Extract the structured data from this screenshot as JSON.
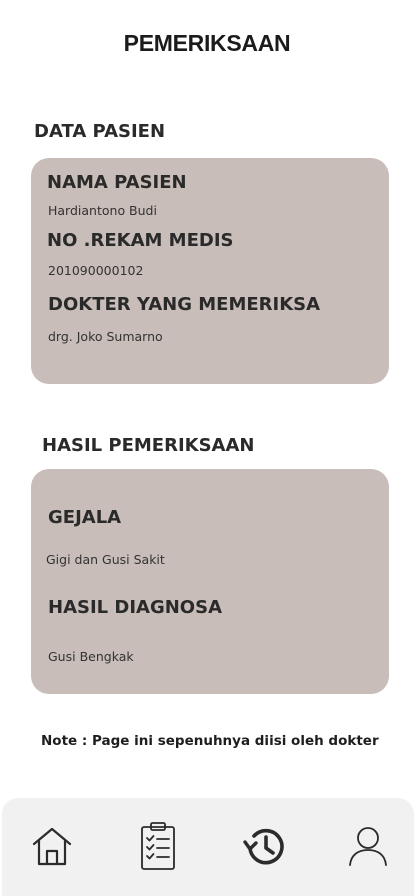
{
  "header": {
    "title": "PEMERIKSAAN"
  },
  "patient_section": {
    "heading": "DATA PASIEN",
    "name_label": "NAMA PASIEN",
    "name_value": "Hardiantono Budi",
    "record_label": "NO .REKAM MEDIS",
    "record_value": "201090000102",
    "doctor_label": "DOKTER YANG MEMERIKSA",
    "doctor_value": "drg. Joko Sumarno"
  },
  "result_section": {
    "heading": "HASIL PEMERIKSAAN",
    "symptom_label": "GEJALA",
    "symptom_value": "Gigi dan Gusi Sakit",
    "diagnosis_label": "HASIL DIAGNOSA",
    "diagnosis_value": "Gusi Bengkak"
  },
  "note": "Note : Page ini sepenuhnya diisi oleh dokter",
  "bottom_nav": {
    "items": [
      {
        "icon": "home-icon"
      },
      {
        "icon": "clipboard-checklist-icon"
      },
      {
        "icon": "history-icon"
      },
      {
        "icon": "user-icon"
      }
    ]
  },
  "colors": {
    "card_background": "#c8bdb8",
    "nav_background": "#f1f1f1",
    "text_primary": "#2a2a2a"
  }
}
